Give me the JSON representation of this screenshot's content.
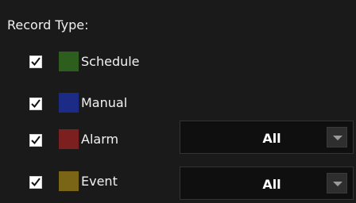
{
  "record_type": {
    "title": "Record Type:",
    "items": [
      {
        "label": "Schedule",
        "checked": true,
        "color": "#2e5e1e"
      },
      {
        "label": "Manual",
        "checked": true,
        "color": "#1b2b86"
      },
      {
        "label": "Alarm",
        "checked": true,
        "color": "#7b1f1f"
      },
      {
        "label": "Event",
        "checked": true,
        "color": "#7a6415"
      }
    ],
    "dropdowns": {
      "alarm": {
        "value": "All"
      },
      "event": {
        "value": "All"
      }
    }
  }
}
